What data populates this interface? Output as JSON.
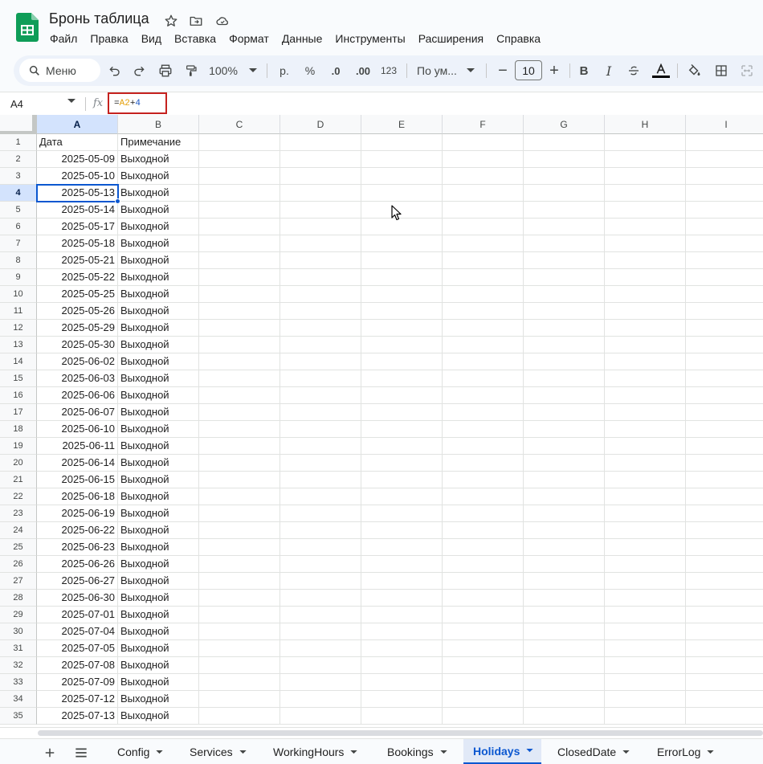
{
  "document": {
    "title": "Бронь таблица"
  },
  "menu": [
    "Файл",
    "Правка",
    "Вид",
    "Вставка",
    "Формат",
    "Данные",
    "Инструменты",
    "Расширения",
    "Справка"
  ],
  "toolbar": {
    "search_label": "Меню",
    "zoom": "100%",
    "currency": "р.",
    "percent": "%",
    "decrease_decimal": ".0",
    "increase_decimal": ".00",
    "number_format": "123",
    "font": "По ум...",
    "font_size": "10",
    "bold": "B",
    "italic": "I"
  },
  "formula_bar": {
    "cell_ref": "A4",
    "formula_eq": "=",
    "formula_ref": "A2",
    "formula_op": "+",
    "formula_num": "4"
  },
  "grid": {
    "columns": [
      "A",
      "B",
      "C",
      "D",
      "E",
      "F",
      "G",
      "H",
      "I"
    ],
    "selected_column": "A",
    "selected_row": 4,
    "rows": [
      {
        "n": "1",
        "a": "Дата",
        "b": "Примечание"
      },
      {
        "n": "2",
        "a": "2025-05-09",
        "b": "Выходной"
      },
      {
        "n": "3",
        "a": "2025-05-10",
        "b": "Выходной"
      },
      {
        "n": "4",
        "a": "2025-05-13",
        "b": "Выходной"
      },
      {
        "n": "5",
        "a": "2025-05-14",
        "b": "Выходной"
      },
      {
        "n": "6",
        "a": "2025-05-17",
        "b": "Выходной"
      },
      {
        "n": "7",
        "a": "2025-05-18",
        "b": "Выходной"
      },
      {
        "n": "8",
        "a": "2025-05-21",
        "b": "Выходной"
      },
      {
        "n": "9",
        "a": "2025-05-22",
        "b": "Выходной"
      },
      {
        "n": "10",
        "a": "2025-05-25",
        "b": "Выходной"
      },
      {
        "n": "11",
        "a": "2025-05-26",
        "b": "Выходной"
      },
      {
        "n": "12",
        "a": "2025-05-29",
        "b": "Выходной"
      },
      {
        "n": "13",
        "a": "2025-05-30",
        "b": "Выходной"
      },
      {
        "n": "14",
        "a": "2025-06-02",
        "b": "Выходной"
      },
      {
        "n": "15",
        "a": "2025-06-03",
        "b": "Выходной"
      },
      {
        "n": "16",
        "a": "2025-06-06",
        "b": "Выходной"
      },
      {
        "n": "17",
        "a": "2025-06-07",
        "b": "Выходной"
      },
      {
        "n": "18",
        "a": "2025-06-10",
        "b": "Выходной"
      },
      {
        "n": "19",
        "a": "2025-06-11",
        "b": "Выходной"
      },
      {
        "n": "20",
        "a": "2025-06-14",
        "b": "Выходной"
      },
      {
        "n": "21",
        "a": "2025-06-15",
        "b": "Выходной"
      },
      {
        "n": "22",
        "a": "2025-06-18",
        "b": "Выходной"
      },
      {
        "n": "23",
        "a": "2025-06-19",
        "b": "Выходной"
      },
      {
        "n": "24",
        "a": "2025-06-22",
        "b": "Выходной"
      },
      {
        "n": "25",
        "a": "2025-06-23",
        "b": "Выходной"
      },
      {
        "n": "26",
        "a": "2025-06-26",
        "b": "Выходной"
      },
      {
        "n": "27",
        "a": "2025-06-27",
        "b": "Выходной"
      },
      {
        "n": "28",
        "a": "2025-06-30",
        "b": "Выходной"
      },
      {
        "n": "29",
        "a": "2025-07-01",
        "b": "Выходной"
      },
      {
        "n": "30",
        "a": "2025-07-04",
        "b": "Выходной"
      },
      {
        "n": "31",
        "a": "2025-07-05",
        "b": "Выходной"
      },
      {
        "n": "32",
        "a": "2025-07-08",
        "b": "Выходной"
      },
      {
        "n": "33",
        "a": "2025-07-09",
        "b": "Выходной"
      },
      {
        "n": "34",
        "a": "2025-07-12",
        "b": "Выходной"
      },
      {
        "n": "35",
        "a": "2025-07-13",
        "b": "Выходной"
      }
    ]
  },
  "sheets": [
    "Config",
    "Services",
    "WorkingHours",
    "Bookings",
    "Holidays",
    "ClosedDate",
    "ErrorLog"
  ],
  "active_sheet": "Holidays",
  "colors": {
    "accent": "#0b57d0",
    "selection_header": "#d3e3fd",
    "formula_highlight": "#c5221f",
    "sheets_green": "#0f9d58"
  },
  "icons": {
    "logo": "google-sheets-logo",
    "star": "star-icon",
    "folder": "move-to-folder-icon",
    "cloud": "cloud-saved-icon"
  }
}
